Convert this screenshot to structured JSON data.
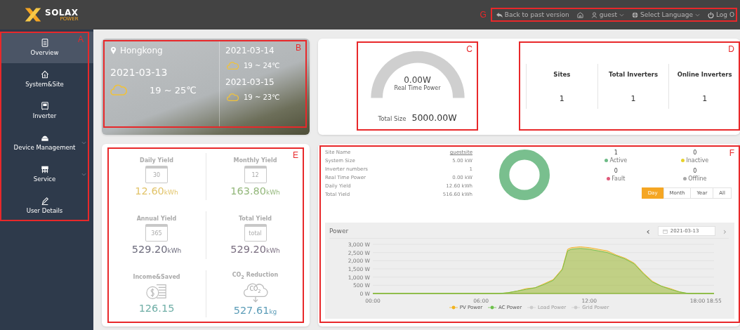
{
  "header": {
    "logo_text": "SOLAX",
    "logo_subtext": "POWER",
    "annotation": "G",
    "actions": [
      {
        "kind": "back",
        "label": "Back to past version"
      },
      {
        "kind": "home"
      },
      {
        "kind": "user",
        "label": "guest",
        "dropdown": true
      },
      {
        "kind": "language",
        "label": "Select Language",
        "dropdown": true
      },
      {
        "kind": "logout",
        "label": "Log O"
      }
    ]
  },
  "sidebar": {
    "annotation": "A",
    "items": [
      {
        "kind": "overview",
        "label": "Overview",
        "selected": true,
        "expandable": false
      },
      {
        "kind": "site",
        "label": "System&Site",
        "selected": false,
        "expandable": false
      },
      {
        "kind": "inverter",
        "label": "Inverter",
        "selected": false,
        "expandable": false
      },
      {
        "kind": "device",
        "label": "Device Management",
        "selected": false,
        "expandable": true
      },
      {
        "kind": "service",
        "label": "Service",
        "selected": false,
        "expandable": true
      },
      {
        "kind": "user",
        "label": "User Details",
        "selected": false,
        "expandable": false
      }
    ]
  },
  "weather": {
    "annotation": "B",
    "location": "Hongkong",
    "today": {
      "date": "2021-03-13",
      "temp": "19 ~ 25℃"
    },
    "forecast": [
      {
        "date": "2021-03-14",
        "temp": "19 ~ 24℃"
      },
      {
        "date": "2021-03-15",
        "temp": "19 ~ 23℃"
      }
    ]
  },
  "gauge": {
    "annotation": "C",
    "value": "0.00W",
    "label": "Real Time Power",
    "total_label": "Total Size",
    "total_value": "5000.00W"
  },
  "stats": {
    "annotation": "D",
    "columns": [
      {
        "label": "Sites",
        "value": "1"
      },
      {
        "label": "Total Inverters",
        "value": "1"
      },
      {
        "label": "Online Inverters",
        "value": "1"
      }
    ]
  },
  "yields": {
    "annotation": "E",
    "items": [
      {
        "label": "Daily Yield",
        "kind": "calendar",
        "icon_text": "30",
        "value": "12.60",
        "unit": "kWh",
        "color": "#e2c46a"
      },
      {
        "label": "Monthly Yield",
        "kind": "calendar",
        "icon_text": "12",
        "value": "163.80",
        "unit": "kWh",
        "color": "#93b77a"
      },
      {
        "label": "Annual Yield",
        "kind": "calendar",
        "icon_text": "365",
        "value": "529.20",
        "unit": "kWh",
        "color": "#6c6b7c"
      },
      {
        "label": "Total Yield",
        "kind": "calendar",
        "icon_text": "total",
        "value": "529.20",
        "unit": "kWh",
        "color": "#7a6e80"
      },
      {
        "label": "Income&Saved",
        "kind": "coins",
        "value": "126.15",
        "color": "#6faea6"
      },
      {
        "label": "CO$_{2}$ Reduction",
        "kind": "co2",
        "icon_text": "CO$_{2}$",
        "value": "527.61",
        "unit": "kg",
        "color": "#5c9db8"
      }
    ]
  },
  "site": {
    "annotation": "F",
    "info": [
      {
        "label": "Site Name",
        "value": "guestsite",
        "link": true
      },
      {
        "label": "System Size",
        "value": "5.00 kW",
        "link": false
      },
      {
        "label": "Inverter numbers",
        "value": "1",
        "link": false
      },
      {
        "label": "Real Time Power",
        "value": "0.00 kW",
        "link": false
      },
      {
        "label": "Daily Yield",
        "value": "12.60 kWh",
        "link": false
      },
      {
        "label": "Total Yield",
        "value": "516.60 kWh",
        "link": false
      }
    ],
    "statuses": [
      {
        "count": "1",
        "label": "Active",
        "color": "#6dbb86"
      },
      {
        "count": "0",
        "label": "Inactive",
        "color": "#e8d22a"
      },
      {
        "count": "0",
        "label": "Fault",
        "color": "#e05a7a"
      },
      {
        "count": "0",
        "label": "Offline",
        "color": "#a8a8a8"
      }
    ],
    "periods": [
      {
        "label": "Day",
        "selected": true
      },
      {
        "label": "Month",
        "selected": false
      },
      {
        "label": "Year",
        "selected": false
      },
      {
        "label": "All",
        "selected": false
      }
    ],
    "power": {
      "title": "Power",
      "date": "2021-03-13",
      "prev": "‹",
      "next": "›",
      "next_disabled": true,
      "inactive_legend": [
        {
          "label": "Load Power"
        },
        {
          "label": "Grid Power"
        }
      ],
      "chart_data": {
        "type": "area",
        "grid": true,
        "x": [
          0,
          1,
          2,
          3,
          4,
          5,
          6,
          7,
          7.5,
          8,
          8.5,
          9,
          9.5,
          10,
          10.5,
          10.8,
          11,
          11.5,
          12,
          12.5,
          13,
          13.5,
          14,
          14.5,
          15,
          15.5,
          16,
          16.5,
          17,
          17.5,
          18,
          18.5,
          18.917
        ],
        "series": [
          {
            "name": "PV Power",
            "color": "#f2b21c",
            "values": [
              0,
              0,
              0,
              0,
              0,
              0,
              0,
              0,
              50,
              150,
              300,
              350,
              600,
              850,
              1500,
              2700,
              2800,
              2850,
              2800,
              2700,
              2600,
              2350,
              2150,
              1850,
              1250,
              750,
              450,
              300,
              100,
              0,
              0,
              0,
              0
            ]
          },
          {
            "name": "AC Power",
            "color": "#6cc04a",
            "values": [
              0,
              0,
              0,
              0,
              0,
              0,
              0,
              0,
              50,
              150,
              250,
              350,
              550,
              800,
              1450,
              2600,
              2700,
              2750,
              2700,
              2600,
              2500,
              2300,
              2100,
              1800,
              1200,
              700,
              450,
              250,
              100,
              0,
              0,
              0,
              0
            ]
          }
        ],
        "xlim": [
          0,
          18.917
        ],
        "ylim": [
          0,
          3000
        ],
        "xticks": [
          {
            "value": 0,
            "label": "00:00"
          },
          {
            "value": 6,
            "label": "06:00"
          },
          {
            "value": 12,
            "label": "12:00"
          },
          {
            "value": 18,
            "label": "18:00"
          },
          {
            "value": 18.917,
            "label": "18:55"
          }
        ],
        "yticks": [
          {
            "value": 0,
            "label": "0 W"
          },
          {
            "value": 500,
            "label": "500 W"
          },
          {
            "value": 1000,
            "label": "1,000 W"
          },
          {
            "value": 1500,
            "label": "1,500 W"
          },
          {
            "value": 2000,
            "label": "2,000 W"
          },
          {
            "value": 2500,
            "label": "2,500 W"
          },
          {
            "value": 3000,
            "label": "3,000 W"
          }
        ]
      }
    }
  }
}
